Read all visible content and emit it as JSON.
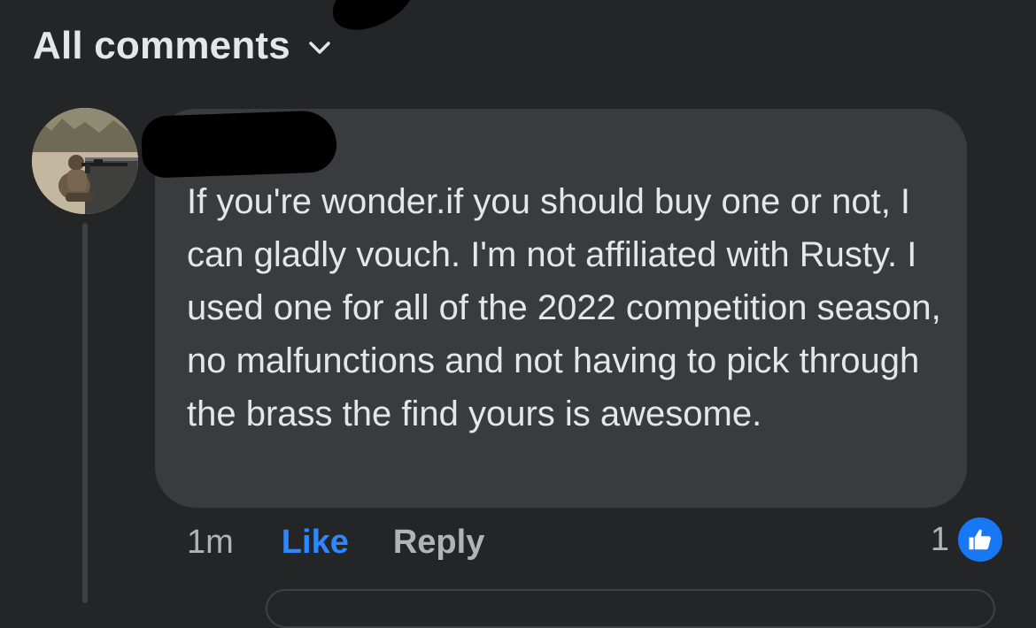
{
  "header": {
    "filter_label": "All comments",
    "filter_icon": "chevron-down-icon"
  },
  "comment": {
    "author_avatar": "avatar",
    "author_name_redacted": true,
    "text": "If you're wonder.if you should buy one or not, I can gladly vouch. I'm not affiliated with Rusty. I used one for all of the 2022 competition season, no malfunctions and not having to pick through the brass the find yours is awesome.",
    "timestamp": "1m",
    "like_label": "Like",
    "reply_label": "Reply",
    "reaction_count": "1",
    "reaction_icon": "thumbs-up-icon"
  },
  "colors": {
    "background": "#242527",
    "bubble": "#3a3b3c",
    "accent": "#2d88ff",
    "badge": "#1877f2",
    "text": "#e4e6eb",
    "muted": "#b0b3b8"
  }
}
